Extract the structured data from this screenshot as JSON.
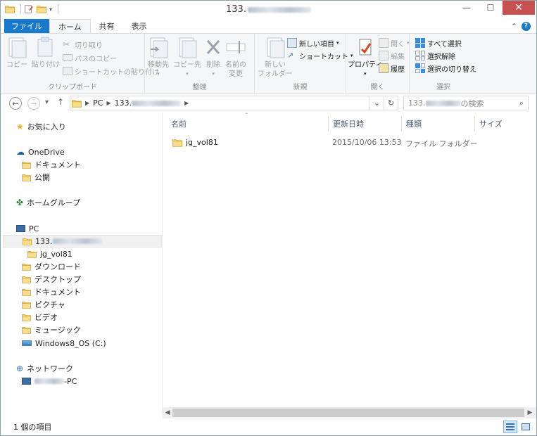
{
  "window": {
    "title": "133."
  },
  "tabs": {
    "file": "ファイル",
    "home": "ホーム",
    "share": "共有",
    "view": "表示"
  },
  "ribbon": {
    "clipboard": {
      "label": "クリップボード",
      "copy": "コピー",
      "paste": "貼り付け",
      "cut": "切り取り",
      "copy_path": "パスのコピー",
      "paste_shortcut": "ショートカットの貼り付け"
    },
    "organize": {
      "label": "整理",
      "move_to": "移動先",
      "copy_to": "コピー先",
      "delete": "削除",
      "rename_1": "名前の",
      "rename_2": "変更"
    },
    "new": {
      "label": "新規",
      "new_folder_1": "新しい",
      "new_folder_2": "フォルダー",
      "new_item": "新しい項目",
      "shortcut": "ショートカット"
    },
    "open": {
      "label": "開く",
      "properties": "プロパティ",
      "open": "開く",
      "edit": "編集",
      "history": "履歴"
    },
    "select": {
      "label": "選択",
      "select_all": "すべて選択",
      "select_none": "選択解除",
      "invert": "選択の切り替え"
    }
  },
  "address": {
    "crumbs": [
      "PC",
      "133."
    ],
    "search_prefix": "133.",
    "search_suffix": "の検索"
  },
  "nav_pane": {
    "favorites": "お気に入り",
    "onedrive": "OneDrive",
    "onedrive_docs": "ドキュメント",
    "onedrive_public": "公開",
    "homegroup": "ホームグループ",
    "pc": "PC",
    "share_prefix": "133.",
    "jg_folder": "jg_vol81",
    "downloads": "ダウンロード",
    "desktop": "デスクトップ",
    "documents": "ドキュメント",
    "pictures": "ピクチャ",
    "videos": "ビデオ",
    "music": "ミュージック",
    "drive": "Windows8_OS (C:)",
    "network": "ネットワーク",
    "network_pc_suffix": "-PC"
  },
  "columns": {
    "name": "名前",
    "modified": "更新日時",
    "type": "種類",
    "size": "サイズ"
  },
  "files": [
    {
      "name": "jg_vol81",
      "modified": "2015/10/06 13:53",
      "type": "ファイル フォルダー",
      "size": ""
    }
  ],
  "status": {
    "count": "1 個の項目"
  },
  "colors": {
    "accent": "#1979ca",
    "folder": "#e8c25a",
    "close": "#c75050"
  }
}
